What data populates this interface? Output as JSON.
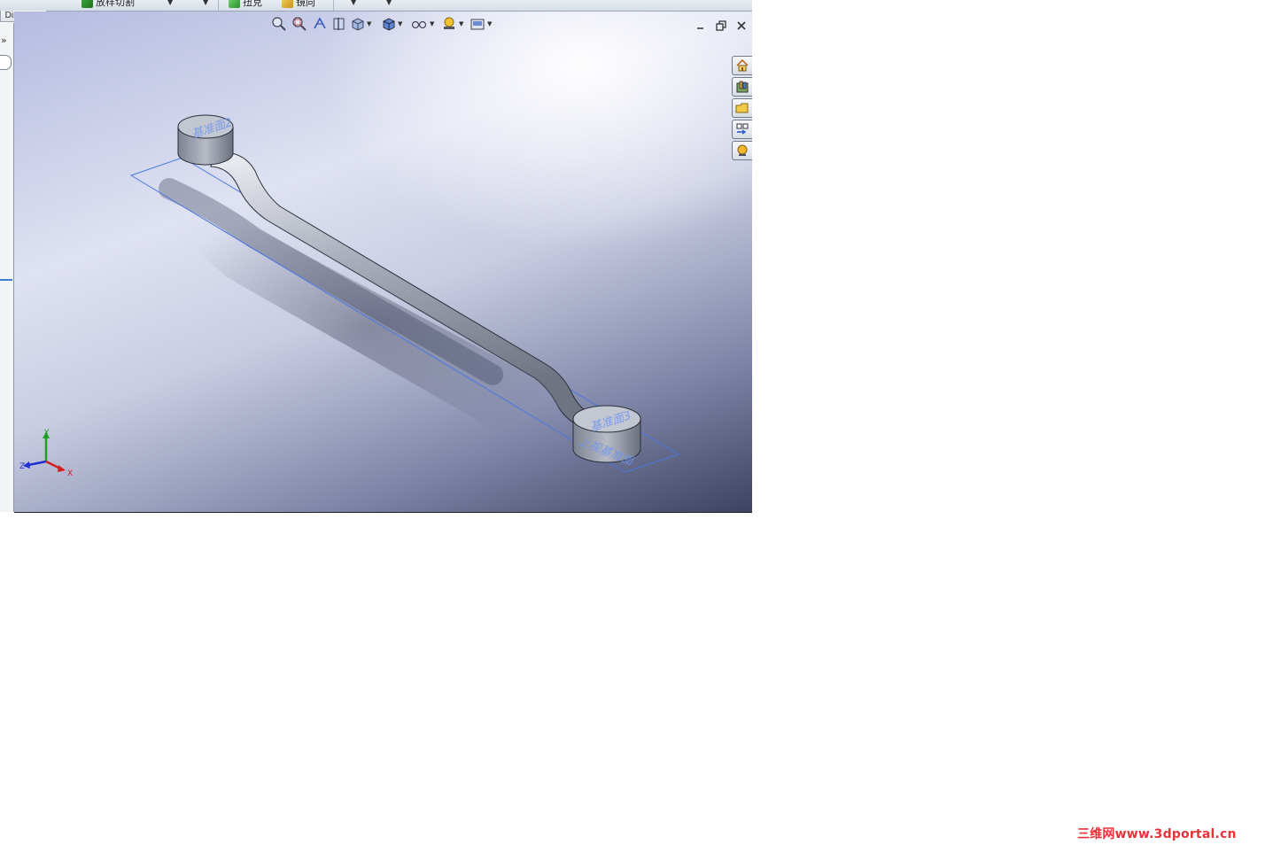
{
  "toolbar": {
    "items": [
      {
        "label": "放样切割"
      },
      {
        "label": "扭克"
      },
      {
        "label": "镜向"
      }
    ]
  },
  "dimxpert_tab": {
    "label": "DimXpert"
  },
  "left_panel": {
    "expand_glyph": "»"
  },
  "view_toolbar": {
    "buttons": [
      {
        "icon": "zoom-to-fit-icon"
      },
      {
        "icon": "zoom-to-area-icon"
      },
      {
        "icon": "previous-view-icon"
      },
      {
        "icon": "section-view-icon"
      },
      {
        "icon": "view-orientation-icon"
      },
      {
        "icon": "display-style-icon"
      },
      {
        "icon": "hide-show-items-icon"
      },
      {
        "icon": "edit-appearance-icon"
      },
      {
        "icon": "apply-scene-icon"
      }
    ]
  },
  "window_controls": {
    "minimize": "minimize-icon",
    "restore": "restore-icon",
    "close": "close-icon"
  },
  "task_pane": {
    "tabs": [
      {
        "icon": "solidworks-resources-icon"
      },
      {
        "icon": "design-library-icon"
      },
      {
        "icon": "file-explorer-icon"
      },
      {
        "icon": "view-palette-icon"
      },
      {
        "icon": "appearances-scenes-icon"
      }
    ]
  },
  "model": {
    "plane_labels": [
      "基准面2",
      "基准面3",
      "上视基准面"
    ],
    "plane_color": "#4a78e0",
    "part_color": "#9aa0ad"
  },
  "triad": {
    "x": "X",
    "y": "Y",
    "z": "Z",
    "x_color": "#d22020",
    "y_color": "#20a020",
    "z_color": "#2030d0"
  },
  "watermark": {
    "text": "三维网www.3dportal.cn",
    "color": "#e8323a"
  }
}
